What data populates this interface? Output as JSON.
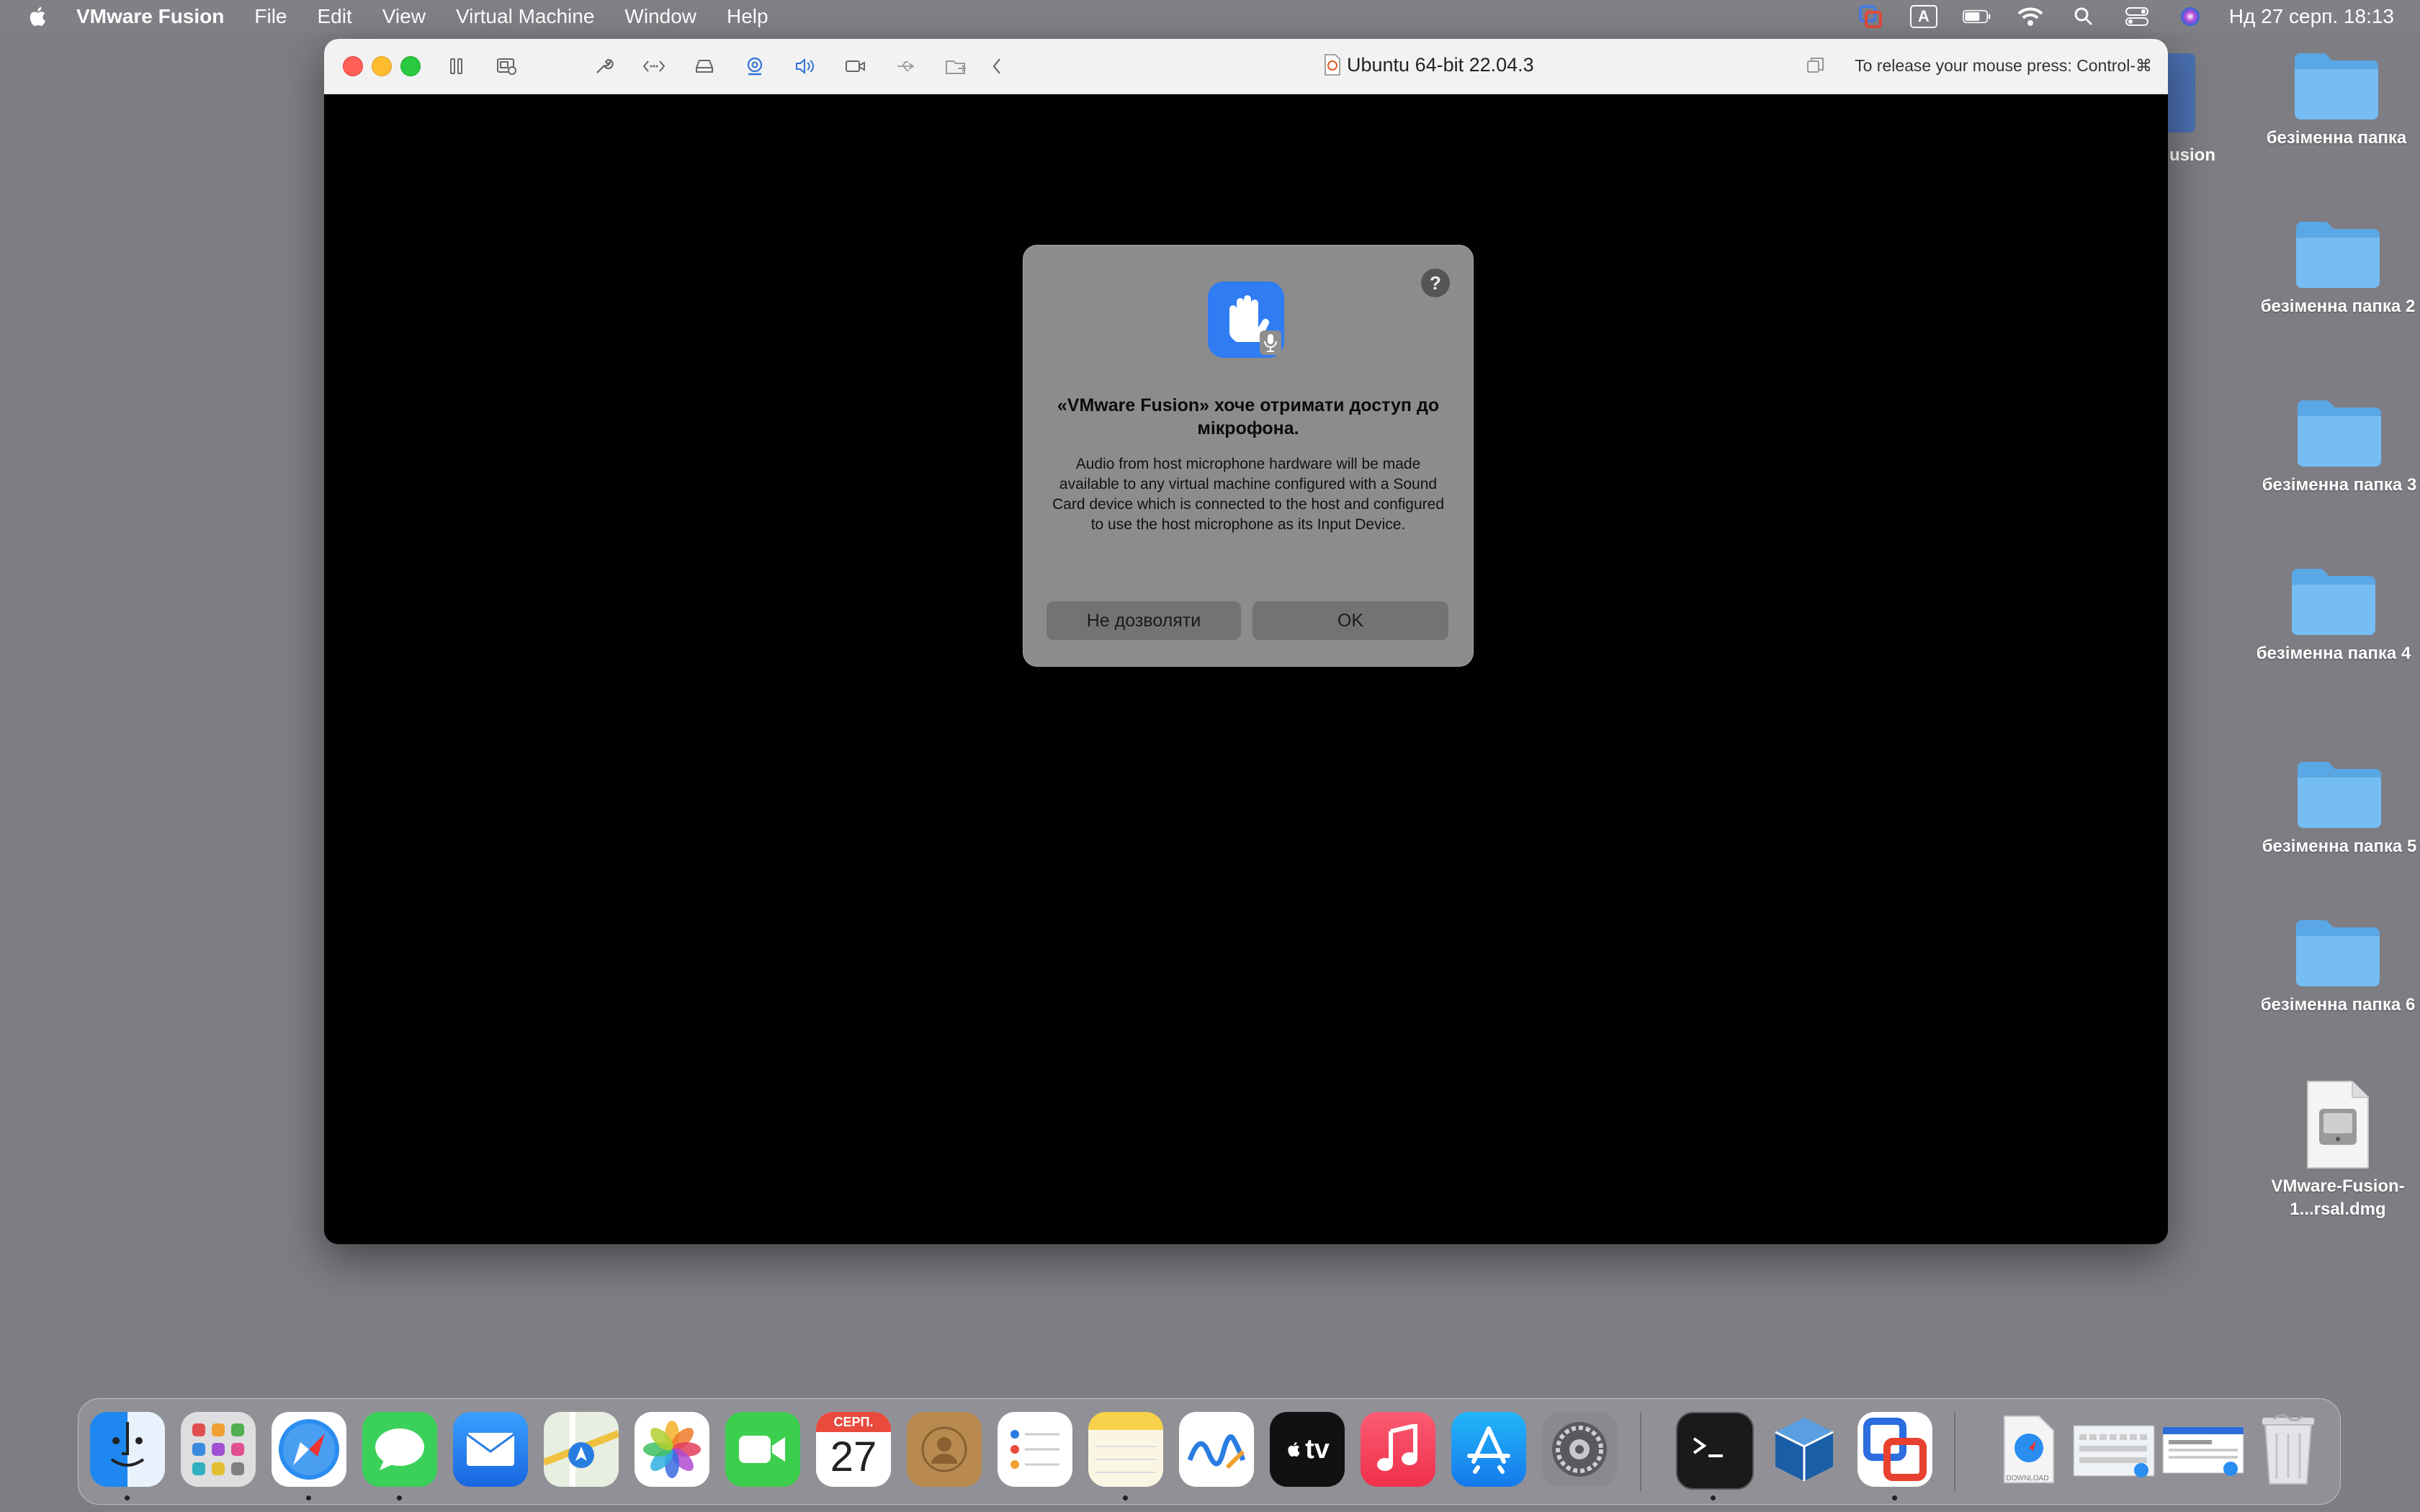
{
  "menubar": {
    "app_name": "VMware Fusion",
    "items": [
      "File",
      "Edit",
      "View",
      "Virtual Machine",
      "Window",
      "Help"
    ],
    "input_source": "A",
    "clock": "Нд 27 серп.  18:13"
  },
  "window": {
    "title": "Ubuntu 64-bit 22.04.3",
    "release_hint": "To release your mouse press: Control-⌘"
  },
  "dialog": {
    "help_label": "?",
    "title": "«VMware Fusion» хоче отримати доступ до мікрофона.",
    "body": "Audio from host microphone hardware will be made available to any virtual machine configured with a Sound Card device which is connected to the host and configured to use the host microphone as its Input Device.",
    "deny_label": "Не дозволяти",
    "ok_label": "OK"
  },
  "desktop": {
    "partial_label": "usion",
    "items": [
      {
        "label": "безіменна папка",
        "type": "folder"
      },
      {
        "label": "безіменна папка 2",
        "type": "folder"
      },
      {
        "label": "безіменна папка 3",
        "type": "folder"
      },
      {
        "label": "безіменна папка 4",
        "type": "folder"
      },
      {
        "label": "безіменна папка 5",
        "type": "folder"
      },
      {
        "label": "безіменна папка 6",
        "type": "folder"
      },
      {
        "label": "VMware-Fusion-1...rsal.dmg",
        "type": "disk-image"
      }
    ]
  },
  "dock": {
    "calendar_month": "СЕРП.",
    "calendar_day": "27",
    "tv_label": "tv",
    "download_label": "DOWNLOAD"
  }
}
